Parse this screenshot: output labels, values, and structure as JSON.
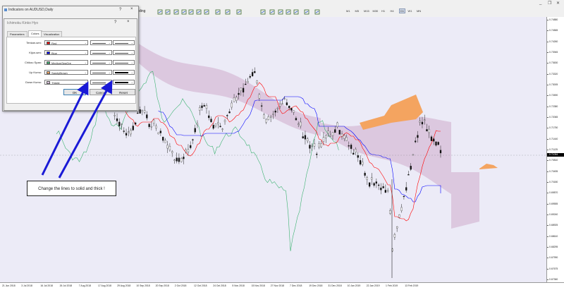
{
  "toolbar": {
    "trading_label": "ding",
    "timeframes": [
      "M1",
      "M5",
      "M15",
      "M30",
      "H1",
      "H4",
      "D1",
      "W1",
      "MN"
    ],
    "selected_timeframe": "D1"
  },
  "dialog_back": {
    "title": "Indicators on AUDUSD,Daily",
    "help": "?",
    "close": "×"
  },
  "dialog": {
    "title": "Ichimoku Kinko Hyo",
    "help": "?",
    "close": "×",
    "tabs": [
      "Parameters",
      "Colors",
      "Visualization"
    ],
    "active_tab": "Colors",
    "rows": [
      {
        "label": "Tenkan-sen:",
        "color": "#ff0000",
        "color_name": "Red",
        "thick": false
      },
      {
        "label": "Kijun-sen:",
        "color": "#0000ff",
        "color_name": "Blue",
        "thick": false
      },
      {
        "label": "Chikou Span:",
        "color": "#3cb371",
        "color_name": "MediumSeaGre",
        "thick": false
      },
      {
        "label": "Up Kumo:",
        "color": "#f4a460",
        "color_name": "SandyBrown",
        "thick": true
      },
      {
        "label": "Down Kumo:",
        "color": "#d8bfd8",
        "color_name": "Thistle",
        "thick": true
      }
    ],
    "buttons": {
      "ok": "OK",
      "cancel": "Cancel",
      "reset": "Reset",
      "close": "Close"
    }
  },
  "callout": {
    "text": "Change the lines to solid and thick !"
  },
  "y_axis": {
    "labels": [
      "0.74880",
      "0.74565",
      "0.74260",
      "0.73945",
      "0.73630",
      "0.73320",
      "0.73005",
      "0.72690",
      "0.72380",
      "0.72065",
      "0.71750",
      "0.71440",
      "0.71125",
      "0.70810",
      "0.70495",
      "0.70180",
      "0.69870",
      "0.69555",
      "0.69240",
      "0.68925",
      "0.68610",
      "0.68295",
      "0.67990",
      "0.67675",
      "0.67360"
    ],
    "current_price": "0.71054"
  },
  "x_axis": {
    "labels": [
      "21 Jun 2018",
      "3 Jul 2018",
      "16 Jul 2018",
      "26 Jul 2018",
      "7 Aug 2018",
      "17 Aug 2018",
      "29 Aug 2018",
      "10 Sep 2018",
      "20 Sep 2018",
      "2 Oct 2018",
      "12 Oct 2018",
      "24 Oct 2018",
      "5 Nov 2018",
      "15 Nov 2018",
      "27 Nov 2018",
      "7 Dec 2018",
      "19 Dec 2018",
      "31 Dec 2018",
      "10 Jan 2019",
      "22 Jan 2019",
      "1 Feb 2019",
      "13 Feb 2019"
    ]
  },
  "colors": {
    "tenkan": "#ff0000",
    "kijun": "#0000ff",
    "chikou": "#3cb371",
    "up_kumo": "#f4a460",
    "down_kumo": "#d8bfd8",
    "arrow": "#1a1ad6",
    "chart_bg": "#ecebf7"
  },
  "toolbar_icons": [
    "new-chart-icon",
    "zoom-in-icon",
    "zoom-out-icon",
    "tile-icon",
    "scroll-icon",
    "autoscroll-icon",
    "indicators-icon",
    "periods-icon",
    "cursor-icon",
    "crosshair-icon",
    "line-icon",
    "hline-icon",
    "channel-icon",
    "fibo-icon",
    "text-icon",
    "label-icon",
    "arrows-icon"
  ]
}
